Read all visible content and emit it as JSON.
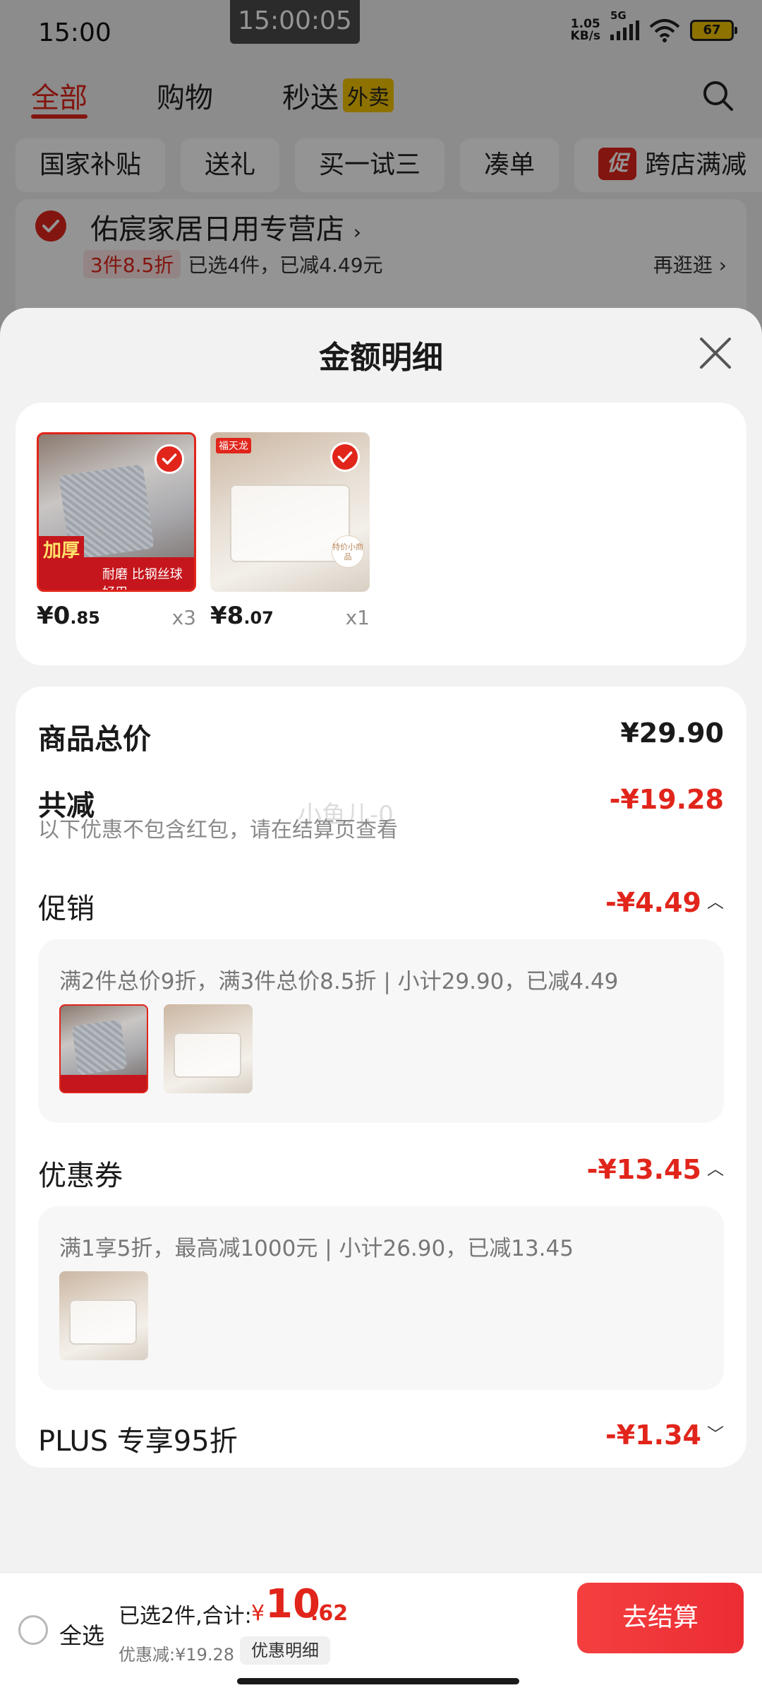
{
  "status_bar": {
    "time": "15:00",
    "clock_overlay": "15:00:05",
    "net_speed_value": "1.05",
    "net_speed_unit": "KB/s",
    "network_type": "5G",
    "battery": "67"
  },
  "top_tabs": {
    "all": "全部",
    "shopping": "购物",
    "instant": "秒送",
    "takeaway_badge": "外卖"
  },
  "filter_chips": [
    "国家补贴",
    "送礼",
    "买一试三",
    "凑单",
    "跨店满减"
  ],
  "filter_chip_promo_badge": "促",
  "store": {
    "name": "佑宸家居日用专营店",
    "promo_tag": "3件8.5折",
    "promo_text": "已选4件，已减4.49元",
    "more": "再逛逛"
  },
  "sheet": {
    "title": "金额明细",
    "products": [
      {
        "price_yuan": "¥0",
        "price_cents": ".85",
        "qty": "x3",
        "promo_thick": "加厚",
        "promo_line": "耐磨 比钢丝球好用",
        "brand": ""
      },
      {
        "price_yuan": "¥8",
        "price_cents": ".07",
        "qty": "x1",
        "brand": "福天龙",
        "badge": "特价小商品"
      }
    ],
    "total_label": "商品总价",
    "total_value": "¥29.90",
    "reduce_label": "共减",
    "reduce_value": "-¥19.28",
    "hint": "以下优惠不包含红包，请在结算页查看",
    "watermark": "小鱼儿-0",
    "promo_label": "促销",
    "promo_value": "-¥4.49",
    "promo_desc": "满2件总价9折，满3件总价8.5折 | 小计29.90，已减4.49",
    "coupon_label": "优惠券",
    "coupon_value": "-¥13.45",
    "coupon_desc": "满1享5折，最高减1000元 | 小计26.90，已减13.45",
    "plus_label": "PLUS 专享95折",
    "plus_value": "-¥1.34"
  },
  "bottom_bar": {
    "select_all": "全选",
    "selected_summary": "已选2件,合计:",
    "currency": "¥",
    "total_int": "10",
    "total_dec": ".62",
    "discount": "优惠减:¥19.28",
    "detail_button": "优惠明细",
    "checkout_button": "去结算"
  },
  "colors": {
    "accent": "#e1251b",
    "sheet_bg": "#f2f2f2",
    "card_bg": "#ffffff"
  }
}
